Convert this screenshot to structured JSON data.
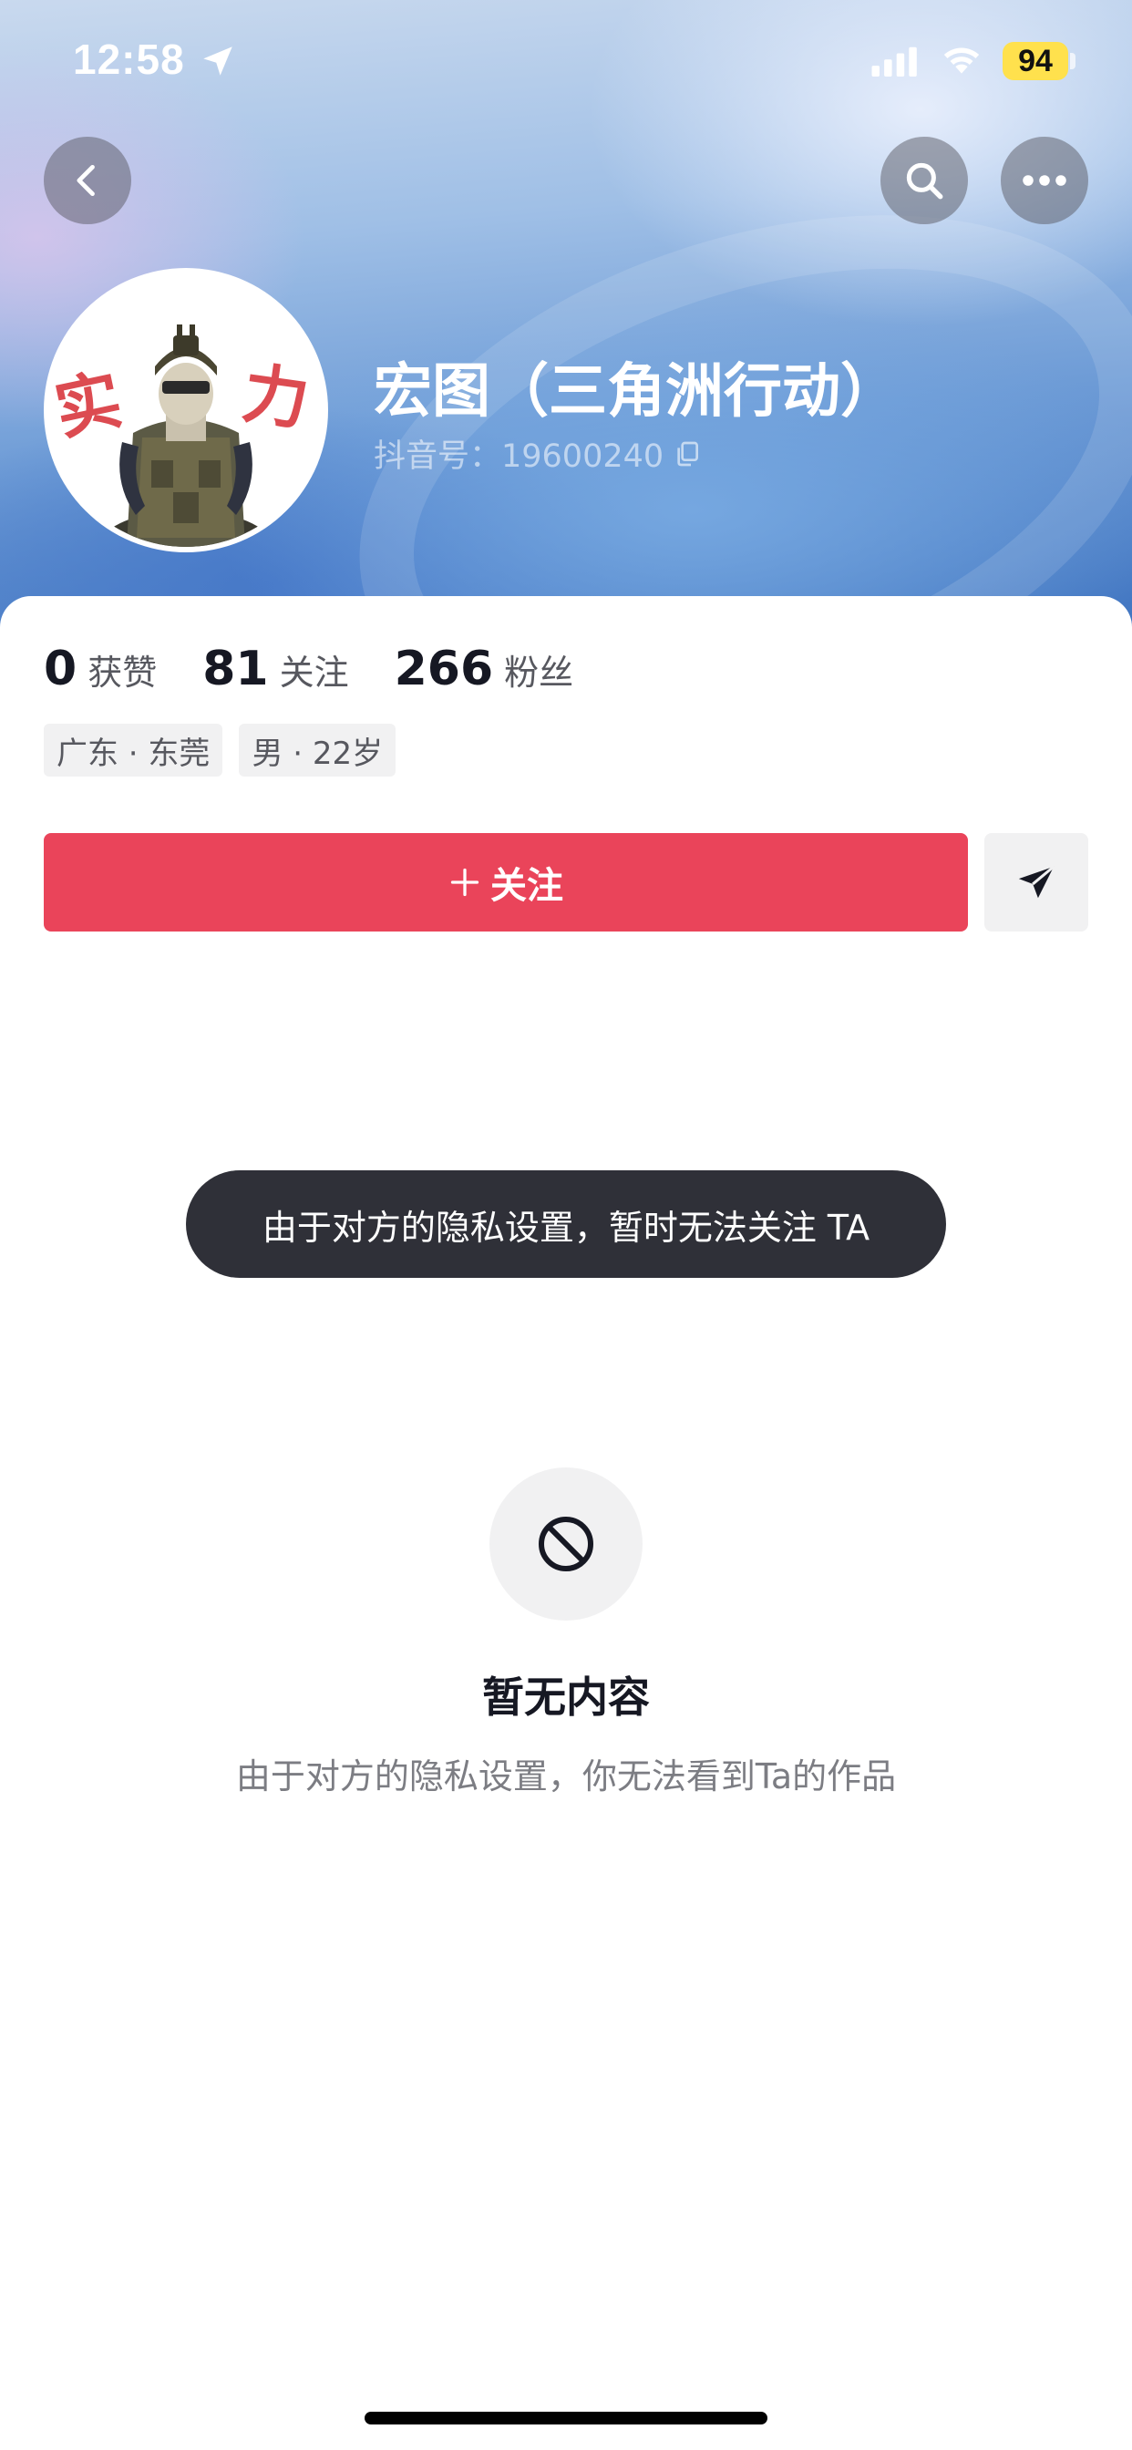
{
  "status_bar": {
    "time": "12:58",
    "battery": "94",
    "icons": [
      "location-arrow-icon",
      "signal-icon",
      "wifi-icon",
      "battery-icon"
    ]
  },
  "nav": {
    "icons": [
      "back-chevron-icon",
      "search-icon",
      "more-icon"
    ]
  },
  "profile": {
    "nickname": "宏图（三角洲行动）",
    "douyin_id": "抖音号：19600240",
    "avatar_text_left": "实",
    "avatar_text_right": "力"
  },
  "stats": [
    {
      "value": "0",
      "label": "获赞"
    },
    {
      "value": "81",
      "label": "关注"
    },
    {
      "value": "266",
      "label": "粉丝"
    }
  ],
  "tags": [
    "广东 · 东莞",
    "男 · 22岁"
  ],
  "actions": {
    "follow_label": "关注",
    "message_icon": "send-icon"
  },
  "toast": "由于对方的隐私设置，暂时无法关注 TA",
  "empty_state": {
    "icon": "blocked-icon",
    "title": "暂无内容",
    "description": "由于对方的隐私设置，你无法看到Ta的作品"
  },
  "colors": {
    "follow_button": "#ea445a",
    "toast_bg": "#2f3038",
    "battery": "#ffe14d"
  }
}
